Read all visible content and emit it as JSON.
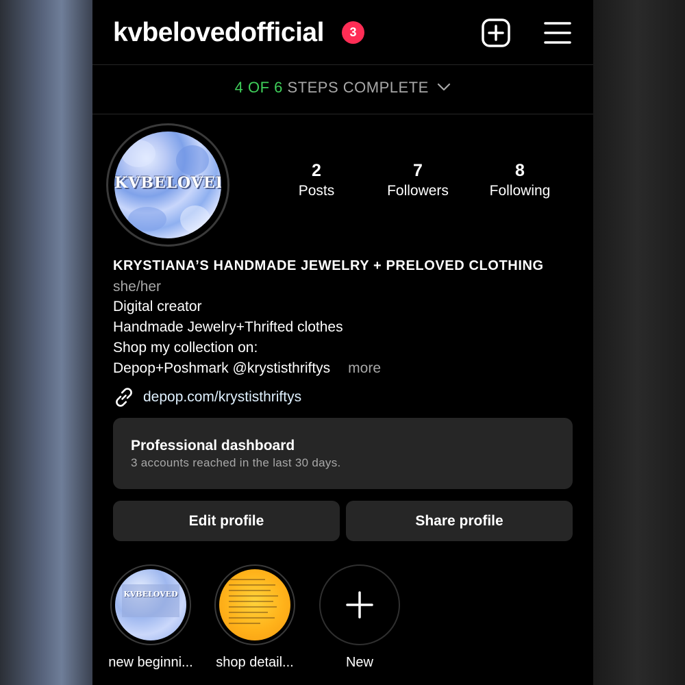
{
  "header": {
    "username": "kvbelovedofficial",
    "notification_count": "3",
    "add_icon": "plus-square-icon",
    "menu_icon": "hamburger-menu-icon"
  },
  "steps": {
    "done": "4",
    "of_text": "OF",
    "total": "6",
    "suffix": "STEPS COMPLETE",
    "chevron_icon": "chevron-down-icon"
  },
  "profile": {
    "avatar_logo_text": "KVBELOVED",
    "stats": [
      {
        "value": "2",
        "label": "Posts"
      },
      {
        "value": "7",
        "label": "Followers"
      },
      {
        "value": "8",
        "label": "Following"
      }
    ],
    "name": "KRYSTIANA’S HANDMADE JEWELRY + PRELOVED CLOTHING",
    "pronouns": "she/her",
    "category": "Digital creator",
    "bio_lines": [
      "Handmade Jewelry+Thrifted clothes",
      "Shop my collection on:",
      "Depop+Poshmark @krystisthriftys"
    ],
    "more_label": "more",
    "link": "depop.com/krystisthriftys",
    "link_icon": "link-icon"
  },
  "dashboard": {
    "title": "Professional dashboard",
    "subtitle": "3 accounts reached in the last 30 days."
  },
  "buttons": {
    "edit": "Edit profile",
    "share": "Share profile"
  },
  "highlights": [
    {
      "label": "new beginni...",
      "cover_text": "KVBELOVED"
    },
    {
      "label": "shop detail..."
    },
    {
      "label": "New",
      "icon": "plus-icon"
    }
  ],
  "colors": {
    "background": "#000000",
    "accent_green": "#3fcf5a",
    "badge_red": "#ff2d55",
    "button_gray": "#262626",
    "muted_text": "#a8a8a8"
  }
}
